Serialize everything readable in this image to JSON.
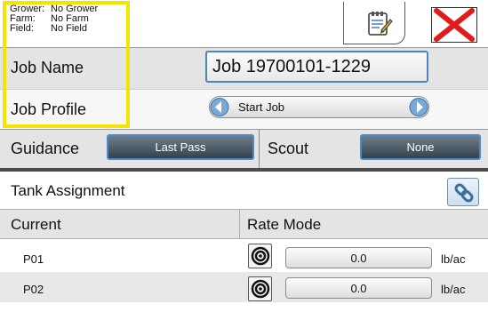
{
  "header": {
    "info": [
      {
        "key": "Grower:",
        "value": "No Grower"
      },
      {
        "key": "Farm:",
        "value": "No Farm"
      },
      {
        "key": "Field:",
        "value": "No Field"
      }
    ]
  },
  "job": {
    "name_label": "Job Name",
    "name_value": "Job 19700101-1229",
    "profile_label": "Job Profile",
    "profile_value": "Start Job"
  },
  "guidance": {
    "label": "Guidance",
    "value": "Last Pass"
  },
  "scout": {
    "label": "Scout",
    "value": "None"
  },
  "tank": {
    "label": "Tank Assignment"
  },
  "products": {
    "col_current": "Current",
    "col_rate_mode": "Rate Mode",
    "rows": [
      {
        "name": "P01",
        "rate": "0.0",
        "unit": "lb/ac"
      },
      {
        "name": "P02",
        "rate": "0.0",
        "unit": "lb/ac"
      }
    ]
  },
  "colors": {
    "highlight": "#f2e600",
    "accent_blue": "#4b8cc8",
    "close_red": "#e11b1b"
  },
  "icons": [
    "notes-edit-icon",
    "close-x-icon",
    "chevron-left-icon",
    "chevron-right-icon",
    "link-icon",
    "target-icon"
  ]
}
